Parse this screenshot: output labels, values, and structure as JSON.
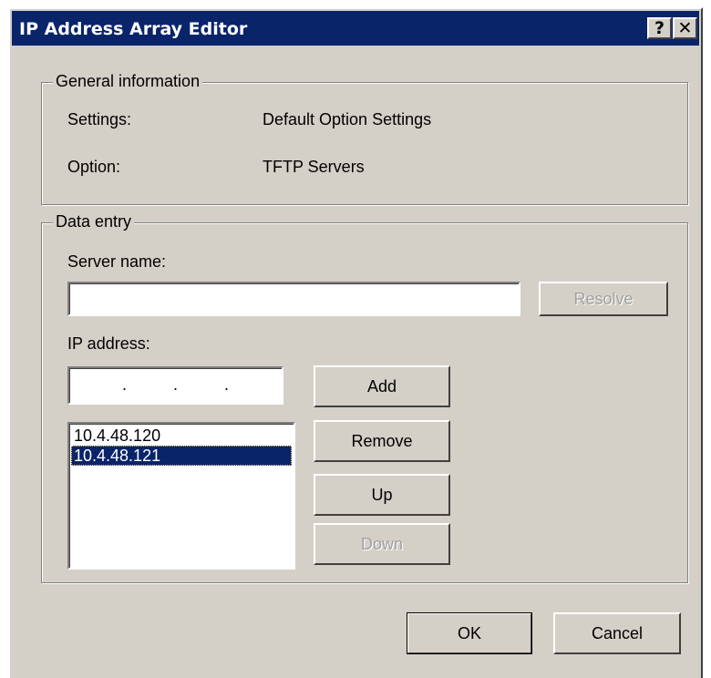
{
  "window": {
    "title": "IP Address Array Editor",
    "help_button": "?",
    "close_button": "✕"
  },
  "general": {
    "legend": "General information",
    "settings_label": "Settings:",
    "settings_value": "Default Option Settings",
    "option_label": "Option:",
    "option_value": "TFTP Servers"
  },
  "data_entry": {
    "legend": "Data entry",
    "server_name_label": "Server name:",
    "server_name_value": "",
    "resolve_button": "Resolve",
    "ip_label": "IP address:",
    "ip_separators": [
      ".",
      ".",
      "."
    ],
    "add_button": "Add",
    "remove_button": "Remove",
    "up_button": "Up",
    "down_button": "Down",
    "ip_list": [
      "10.4.48.120",
      "10.4.48.121"
    ],
    "selected_index": 1
  },
  "footer": {
    "ok_button": "OK",
    "cancel_button": "Cancel"
  }
}
